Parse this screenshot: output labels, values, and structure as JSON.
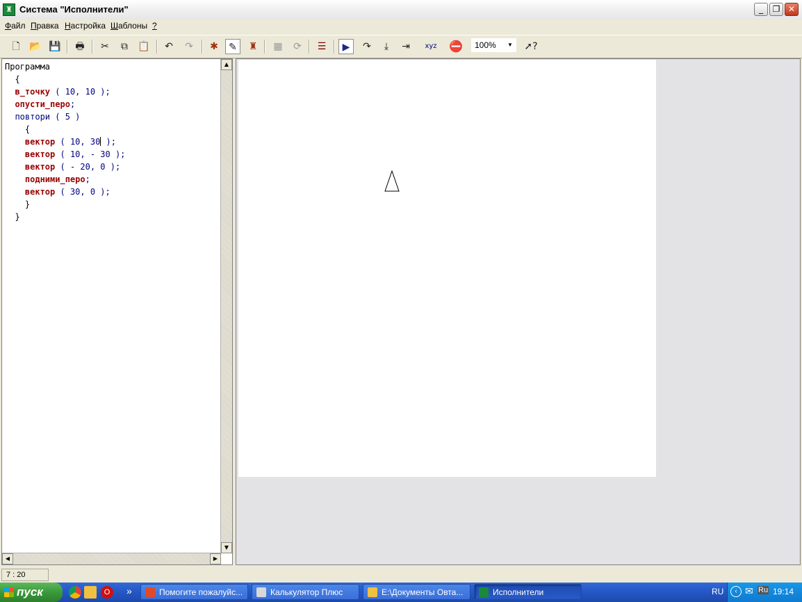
{
  "window": {
    "title": "Система \"Исполнители\"",
    "minimize_glyph": "_",
    "restore_glyph": "❐",
    "close_glyph": "✕"
  },
  "menu": {
    "items": [
      {
        "accel": "Ф",
        "rest": "айл"
      },
      {
        "accel": "П",
        "rest": "равка"
      },
      {
        "accel": "Н",
        "rest": "астройка"
      },
      {
        "accel": "Ш",
        "rest": "аблоны"
      },
      {
        "accel": "?",
        "rest": ""
      }
    ]
  },
  "toolbar": {
    "zoom_value": "100%",
    "icons": [
      "new-file-icon",
      "open-folder-icon",
      "save-icon",
      "print-icon",
      "cut-icon",
      "copy-icon",
      "paste-icon",
      "undo-icon",
      "redo-icon",
      "turtle-executor-icon",
      "draftsman-executor-icon",
      "robot-executor-icon",
      "grid-icon",
      "refresh-icon",
      "format-code-icon",
      "run-icon",
      "step-over-icon",
      "step-into-icon",
      "run-to-cursor-icon",
      "coordinates-icon",
      "stop-icon",
      "help-icon"
    ]
  },
  "editor": {
    "lines": [
      {
        "indent": "",
        "parts": [
          {
            "t": "Программа",
            "c": ""
          }
        ]
      },
      {
        "indent": "  ",
        "parts": [
          {
            "t": "{",
            "c": ""
          }
        ]
      },
      {
        "indent": "  ",
        "parts": [
          {
            "t": "в_точку",
            "c": "kw"
          },
          {
            "t": " ( 10, 10 );",
            "c": "nb"
          }
        ]
      },
      {
        "indent": "  ",
        "parts": [
          {
            "t": "опусти_перо",
            "c": "kw"
          },
          {
            "t": ";",
            "c": "nb"
          }
        ]
      },
      {
        "indent": "  ",
        "parts": [
          {
            "t": "повтори ( 5 )",
            "c": "nb"
          }
        ]
      },
      {
        "indent": "    ",
        "parts": [
          {
            "t": "{",
            "c": ""
          }
        ]
      },
      {
        "indent": "    ",
        "parts": [
          {
            "t": "вектор",
            "c": "kw"
          },
          {
            "t": " ( 10, 30",
            "c": "nb"
          },
          {
            "t": "|",
            "c": "cursor"
          },
          {
            "t": " );",
            "c": "nb"
          }
        ]
      },
      {
        "indent": "    ",
        "parts": [
          {
            "t": "вектор",
            "c": "kw"
          },
          {
            "t": " ( 10, - 30 );",
            "c": "nb"
          }
        ]
      },
      {
        "indent": "    ",
        "parts": [
          {
            "t": "вектор",
            "c": "kw"
          },
          {
            "t": " ( - 20, 0 );",
            "c": "nb"
          }
        ]
      },
      {
        "indent": "    ",
        "parts": [
          {
            "t": "подними_перо",
            "c": "kw"
          },
          {
            "t": ";",
            "c": "nb"
          }
        ]
      },
      {
        "indent": "    ",
        "parts": [
          {
            "t": "вектор",
            "c": "kw"
          },
          {
            "t": " ( 30, 0 );",
            "c": "nb"
          }
        ]
      },
      {
        "indent": "    ",
        "parts": [
          {
            "t": "}",
            "c": ""
          }
        ]
      },
      {
        "indent": "  ",
        "parts": [
          {
            "t": "}",
            "c": ""
          }
        ]
      }
    ]
  },
  "status": {
    "cursor_pos": "7 : 20"
  },
  "taskbar": {
    "start_label": "пуск",
    "overflow_glyph": "»",
    "tasks": [
      {
        "label": "Помогите пожалуйс...",
        "icon_color": "#e04a2a"
      },
      {
        "label": "Калькулятор Плюс",
        "icon_color": "#d8d8d8"
      },
      {
        "label": "E:\\Документы Овта...",
        "icon_color": "#f0c040"
      },
      {
        "label": "Исполнители",
        "icon_color": "#1a8a3a"
      }
    ],
    "lang": "RU",
    "lang2": "Ru",
    "clock": "19:14"
  }
}
